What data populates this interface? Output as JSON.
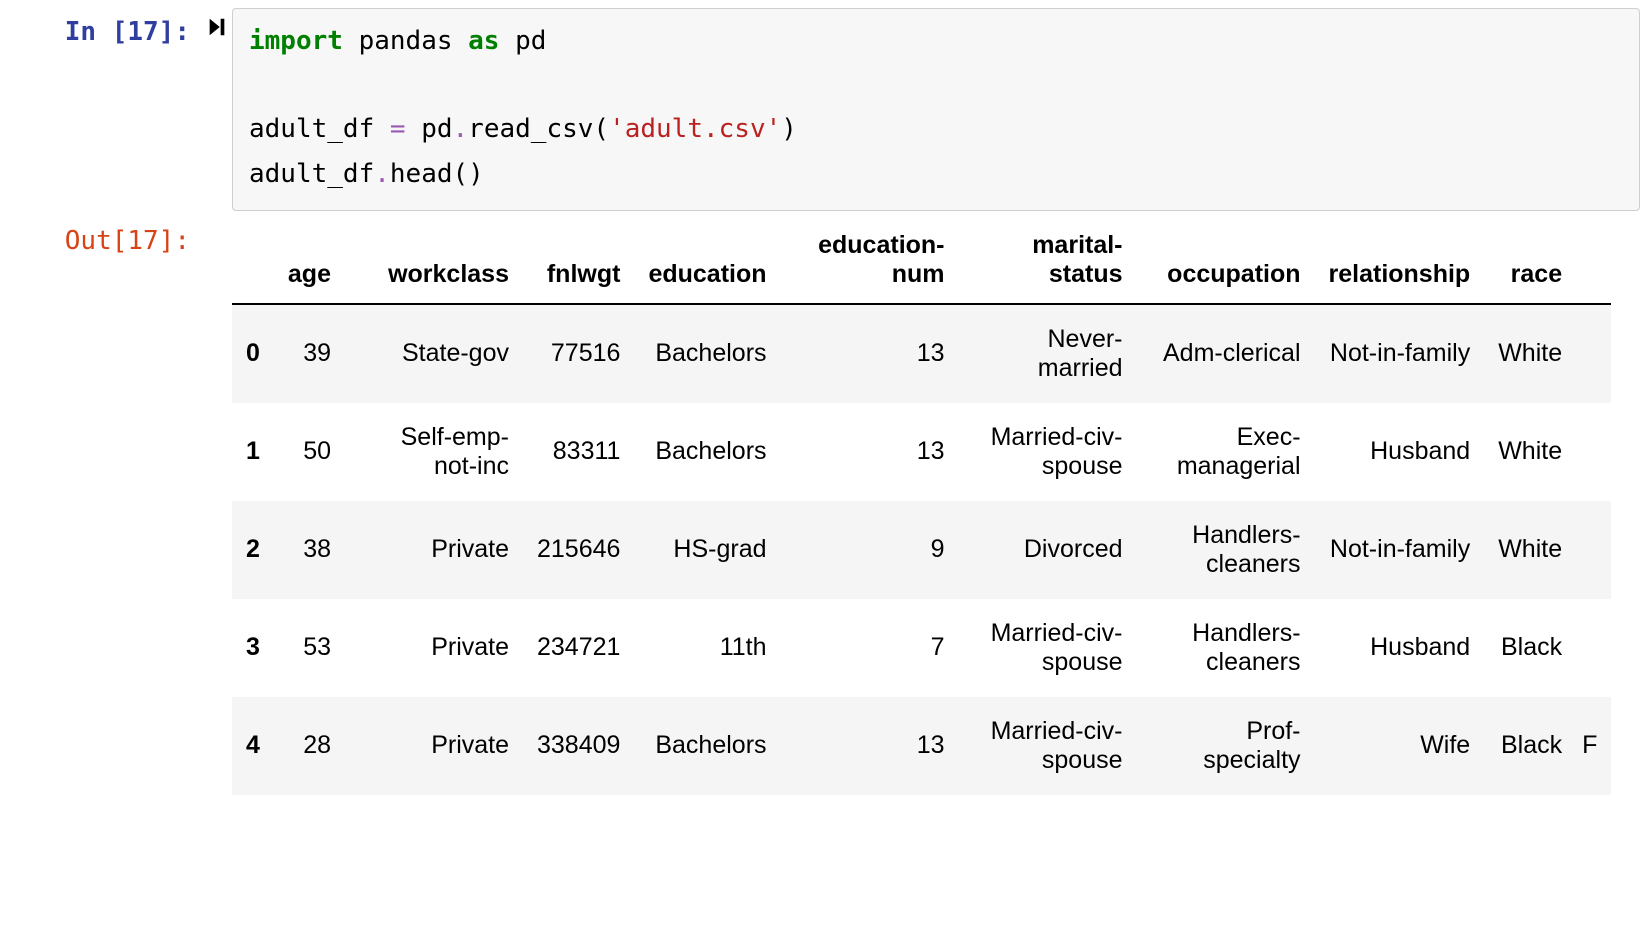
{
  "cell": {
    "in_prompt": "In [17]:",
    "out_prompt": "Out[17]:",
    "code_tokens": [
      {
        "t": "import",
        "c": "kw"
      },
      {
        "t": " pandas ",
        "c": ""
      },
      {
        "t": "as",
        "c": "kw"
      },
      {
        "t": " pd",
        "c": ""
      },
      {
        "t": "\n\n",
        "c": ""
      },
      {
        "t": "adult_df ",
        "c": ""
      },
      {
        "t": "=",
        "c": "op"
      },
      {
        "t": " pd",
        "c": ""
      },
      {
        "t": ".",
        "c": "op"
      },
      {
        "t": "read_csv(",
        "c": ""
      },
      {
        "t": "'adult.csv'",
        "c": "str"
      },
      {
        "t": ")",
        "c": ""
      },
      {
        "t": "\n",
        "c": ""
      },
      {
        "t": "adult_df",
        "c": ""
      },
      {
        "t": ".",
        "c": "op"
      },
      {
        "t": "head()",
        "c": ""
      }
    ]
  },
  "dataframe": {
    "columns": [
      "age",
      "workclass",
      "fnlwgt",
      "education",
      "education-num",
      "marital-status",
      "occupation",
      "relationship",
      "race"
    ],
    "index": [
      "0",
      "1",
      "2",
      "3",
      "4"
    ],
    "narrow_cols": [
      "workclass",
      "education-num",
      "marital-status",
      "occupation"
    ],
    "rows": [
      [
        "39",
        "State-gov",
        "77516",
        "Bachelors",
        "13",
        "Never-married",
        "Adm-clerical",
        "Not-in-family",
        "White"
      ],
      [
        "50",
        "Self-emp-not-inc",
        "83311",
        "Bachelors",
        "13",
        "Married-civ-spouse",
        "Exec-managerial",
        "Husband",
        "White"
      ],
      [
        "38",
        "Private",
        "215646",
        "HS-grad",
        "9",
        "Divorced",
        "Handlers-cleaners",
        "Not-in-family",
        "White"
      ],
      [
        "53",
        "Private",
        "234721",
        "11th",
        "7",
        "Married-civ-spouse",
        "Handlers-cleaners",
        "Husband",
        "Black"
      ],
      [
        "28",
        "Private",
        "338409",
        "Bachelors",
        "13",
        "Married-civ-spouse",
        "Prof-specialty",
        "Wife",
        "Black"
      ]
    ],
    "trailing_partial": "F"
  }
}
